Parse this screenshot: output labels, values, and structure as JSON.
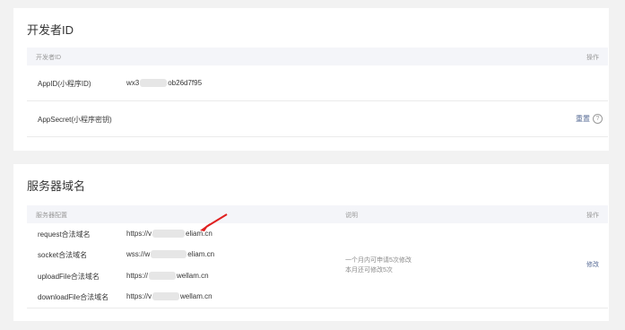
{
  "developer": {
    "title": "开发者ID",
    "header": {
      "col1": "开发者ID",
      "action": "操作"
    },
    "appid": {
      "label": "AppID(小程序ID)",
      "value_prefix": "wx3",
      "value_suffix": "ob26d7f95"
    },
    "secret": {
      "label": "AppSecret(小程序密钥)",
      "reset": "重置",
      "help": "?"
    }
  },
  "server": {
    "title": "服务器域名",
    "header": {
      "config": "服务器配置",
      "desc": "说明",
      "action": "操作"
    },
    "rows": [
      {
        "label": "request合法域名",
        "prefix": "https://v",
        "suffix": "eliam.cn"
      },
      {
        "label": "socket合法域名",
        "prefix": "wss://w",
        "suffix": "eliam.cn"
      },
      {
        "label": "uploadFile合法域名",
        "prefix": "https://",
        "suffix": "wellam.cn"
      },
      {
        "label": "downloadFile合法域名",
        "prefix": "https://v",
        "suffix": "wellam.cn"
      }
    ],
    "desc_line1": "一个月内可申请5次修改",
    "desc_line2": "本月还可修改5次",
    "modify": "修改"
  },
  "colors": {
    "link": "#576b95",
    "arrow": "#e02020",
    "header_bg": "#f4f5f9"
  }
}
